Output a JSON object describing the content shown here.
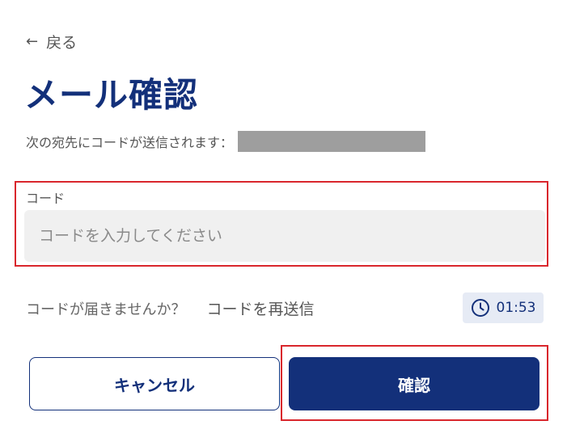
{
  "back": {
    "arrow": "←",
    "label": "戻る"
  },
  "title": "メール確認",
  "recipient": {
    "text": "次の宛先にコードが送信されます："
  },
  "code": {
    "label": "コード",
    "placeholder": "コードを入力してください",
    "value": ""
  },
  "resend": {
    "question": "コードが届きませんか？",
    "link": "コードを再送信"
  },
  "timer": {
    "icon": "clock-icon",
    "value": "01:53"
  },
  "buttons": {
    "cancel": "キャンセル",
    "confirm": "確認"
  },
  "colors": {
    "brand": "#13307a",
    "highlight": "#d9262c",
    "input_bg": "#f0f0f0",
    "timer_bg": "#e6ebf5",
    "redaction": "#9e9e9e"
  }
}
